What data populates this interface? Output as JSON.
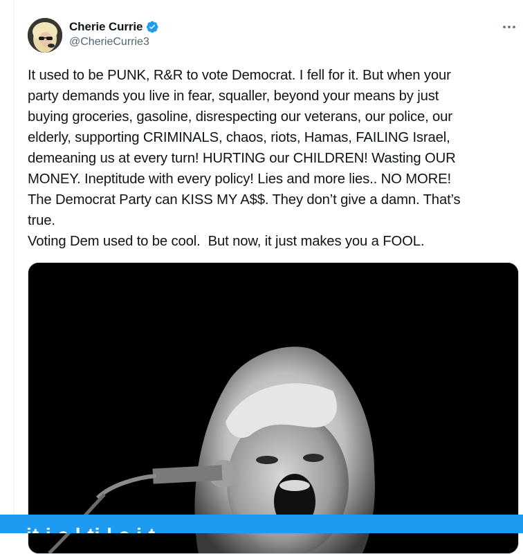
{
  "tweet": {
    "author": {
      "display_name": "Cherie Currie",
      "handle": "@CherieCurrie3",
      "verified": true,
      "verified_color": "#1d9bf0"
    },
    "more_icon": "ellipsis-icon",
    "text": "It used to be PUNK, R&R to vote Democrat. I fell for it. But when your\nparty demands you live in fear, squaller, beyond your means by just\nbuying groceries, gasoline, disrespecting our veterans, our police, our\nelderly, supporting CRIMINALS, chaos, riots, Hamas, FAILING Israel,\ndemeaning us at every turn! HURTING our CHILDREN! Wasting OUR\nMONEY. Ineptitude with every policy! Lies and more lies.. NO MORE!\nThe Democrat Party can KISS MY A$$. They don’t give a damn. That’s\ntrue.\nVoting Dem used to be cool.  But now, it just makes you a FOOL.",
    "media": {
      "type": "photo",
      "style": "black-and-white"
    }
  },
  "bottom_bar": {
    "text": "it  i  e  l  ti  l     e  i  t",
    "color": "#1d9bf0"
  },
  "colors": {
    "text_primary": "#0f1419",
    "text_secondary": "#536471",
    "border": "#cfd9de"
  }
}
